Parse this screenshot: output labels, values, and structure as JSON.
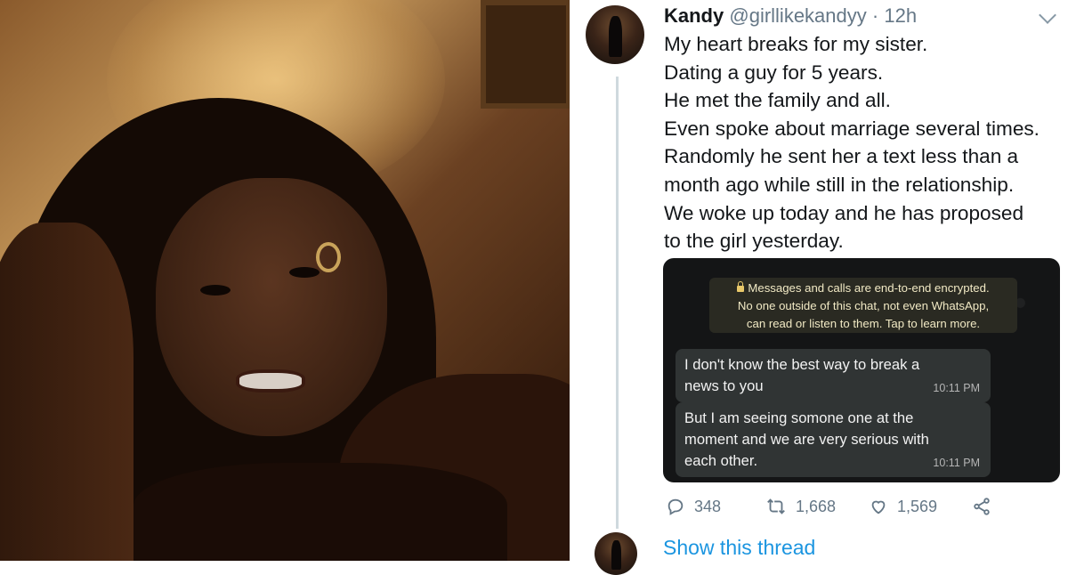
{
  "tweet": {
    "display_name": "Kandy",
    "handle": "@girllikekandyy",
    "separator": "·",
    "time": "12h",
    "lines": [
      "My heart breaks for my sister.",
      "Dating a guy for 5 years.",
      "He met the family and all.",
      "Even spoke about marriage several times.",
      "Randomly he sent her a text less than a",
      "month ago while still in the relationship.",
      "We woke up today and he has proposed",
      "to the girl yesterday."
    ],
    "reply_count": "348",
    "retweet_count": "1,668",
    "like_count": "1,569",
    "show_thread": "Show this thread"
  },
  "whatsapp": {
    "notice_lines": [
      "Messages and calls are end-to-end encrypted.",
      "No one outside of this chat, not even WhatsApp,",
      "can read or listen to them. Tap to learn more."
    ],
    "messages": [
      {
        "lines": [
          "I don't know the best way to break a",
          "news to you"
        ],
        "time": "10:11 PM"
      },
      {
        "lines": [
          "But I am seeing somone one at the",
          "moment and we are very serious with",
          "each other."
        ],
        "time": "10:11 PM"
      }
    ]
  },
  "colors": {
    "link": "#1b95e0",
    "muted": "#657786",
    "text": "#14171a",
    "whatsapp_bg": "#141516"
  },
  "icons": [
    "reply-icon",
    "retweet-icon",
    "like-icon",
    "share-icon",
    "chevron-down-icon",
    "lock-icon"
  ]
}
